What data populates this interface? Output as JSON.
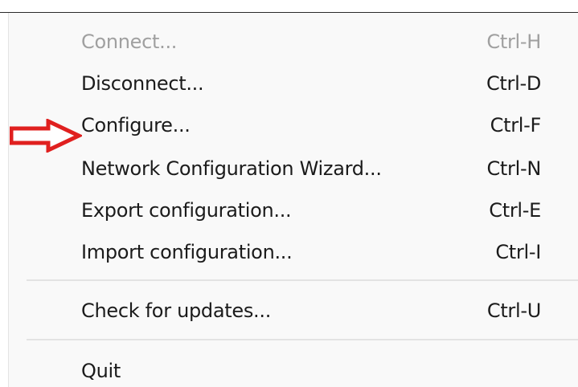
{
  "menu": {
    "items": [
      {
        "label": "Connect...",
        "shortcut": "Ctrl-H",
        "enabled": false
      },
      {
        "label": "Disconnect...",
        "shortcut": "Ctrl-D",
        "enabled": true
      },
      {
        "label": "Configure...",
        "shortcut": "Ctrl-F",
        "enabled": true
      },
      {
        "label": "Network Configuration Wizard...",
        "shortcut": "Ctrl-N",
        "enabled": true
      },
      {
        "label": "Export configuration...",
        "shortcut": "Ctrl-E",
        "enabled": true
      },
      {
        "label": "Import configuration...",
        "shortcut": "Ctrl-I",
        "enabled": true
      },
      {
        "label": "Check for updates...",
        "shortcut": "Ctrl-U",
        "enabled": true
      },
      {
        "label": "Quit",
        "shortcut": "",
        "enabled": true
      }
    ]
  },
  "annotation": {
    "arrow_color": "#e0201f",
    "target_item": "Configure..."
  },
  "colors": {
    "text": "#1b1b1b",
    "disabled_text": "#a0a0a0",
    "menu_background": "#f9f9f9",
    "separator": "#e3e3e3"
  }
}
